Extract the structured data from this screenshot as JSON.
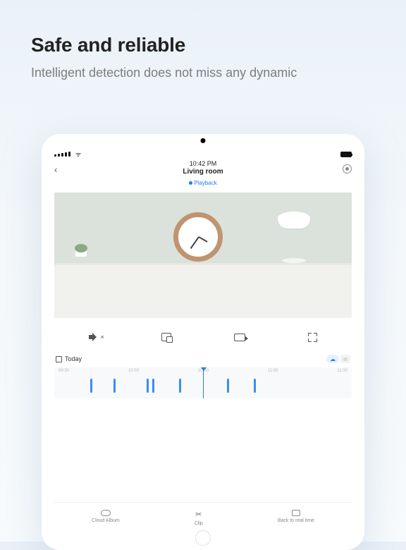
{
  "hero": {
    "title": "Safe and reliable",
    "subtitle": "Intelligent detection does not miss any dynamic"
  },
  "status": {
    "time": "10:42 PM"
  },
  "header": {
    "room": "Living room",
    "playback": "Playback"
  },
  "timeline": {
    "day_label": "Today",
    "ticks": [
      "09:30",
      "10:00",
      "10:30",
      "11:00",
      "11:30"
    ],
    "marks_pct": [
      12,
      20,
      31,
      33,
      42,
      58,
      67
    ]
  },
  "footer": {
    "cloud_album": "Cloud Album",
    "clip": "Clip",
    "back_realtime": "Back to real time"
  }
}
